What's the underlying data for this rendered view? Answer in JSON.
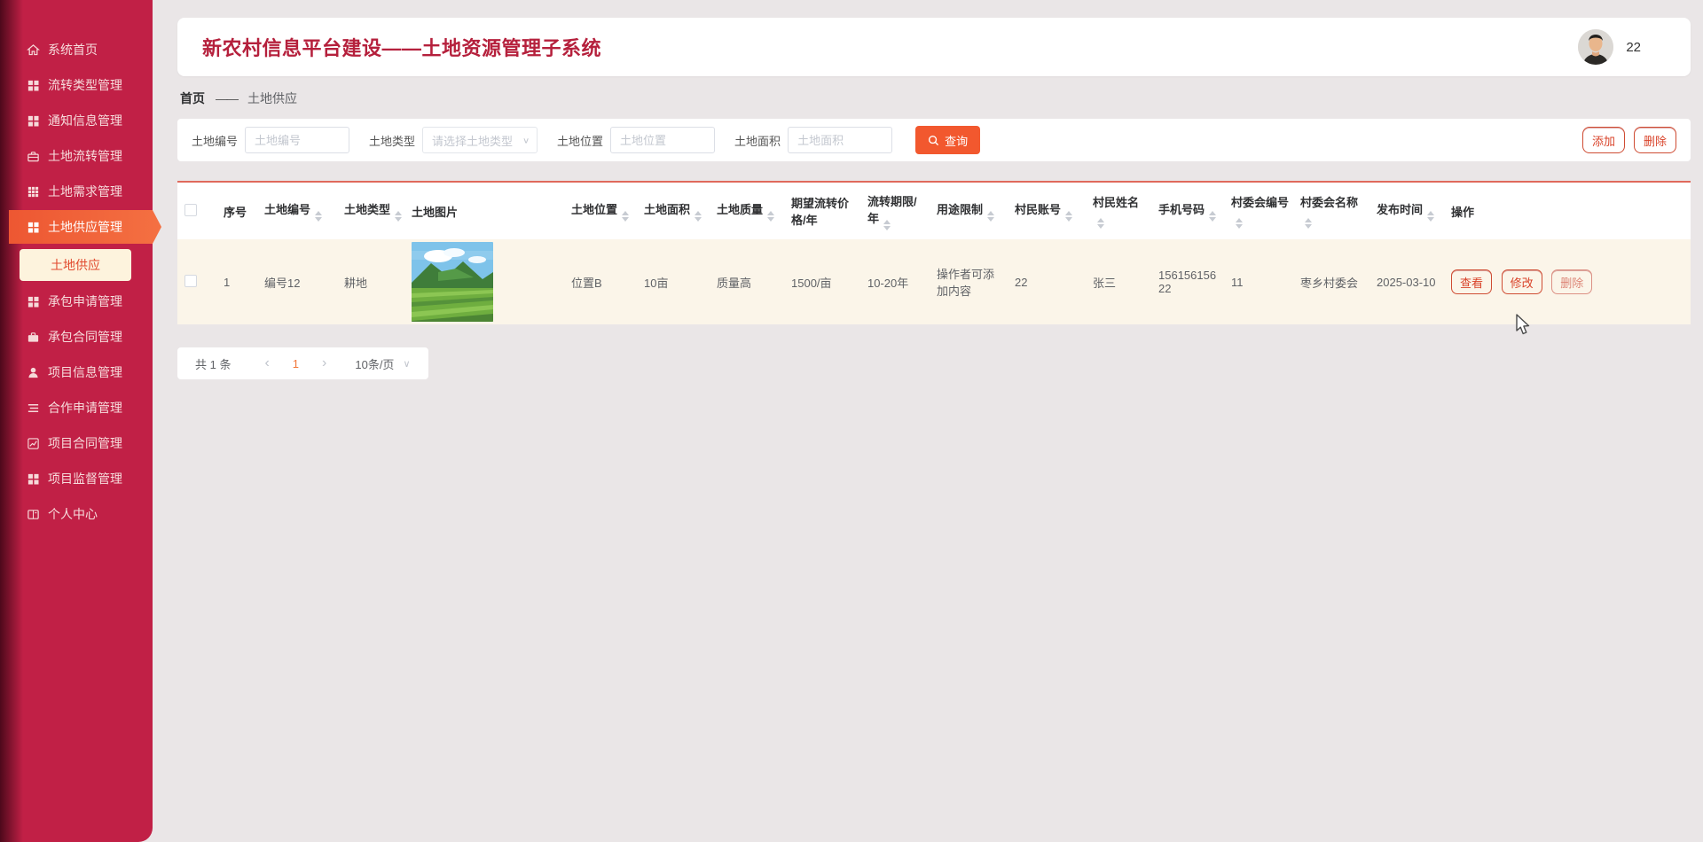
{
  "app": {
    "title": "新农村信息平台建设——土地资源管理子系统",
    "user_badge": "22"
  },
  "colors": {
    "sidebar": "#c12046",
    "active_item": "#f05a32",
    "title_red": "#b5203c",
    "primary_button": "#f2582e",
    "row_highlight": "#fbf5e9"
  },
  "sidebar": {
    "items": [
      {
        "label": "系统首页",
        "icon": "home-icon"
      },
      {
        "label": "流转类型管理",
        "icon": "grid-icon"
      },
      {
        "label": "通知信息管理",
        "icon": "grid-icon"
      },
      {
        "label": "土地流转管理",
        "icon": "briefcase-icon"
      },
      {
        "label": "土地需求管理",
        "icon": "table-grid-icon"
      },
      {
        "label": "土地供应管理",
        "icon": "grid-icon"
      },
      {
        "label": "承包申请管理",
        "icon": "grid-icon"
      },
      {
        "label": "承包合同管理",
        "icon": "briefcase-icon"
      },
      {
        "label": "项目信息管理",
        "icon": "user-icon"
      },
      {
        "label": "合作申请管理",
        "icon": "list-icon"
      },
      {
        "label": "项目合同管理",
        "icon": "chart-icon"
      },
      {
        "label": "项目监督管理",
        "icon": "grid-icon"
      },
      {
        "label": "个人中心",
        "icon": "card-icon"
      }
    ],
    "active_item": "土地供应管理",
    "submenu": {
      "label": "土地供应"
    }
  },
  "breadcrumb": {
    "root": "首页",
    "separator": "——",
    "current": "土地供应"
  },
  "filters": {
    "fields": [
      {
        "label": "土地编号",
        "placeholder": "土地编号",
        "type": "input"
      },
      {
        "label": "土地类型",
        "placeholder": "请选择土地类型",
        "type": "select"
      },
      {
        "label": "土地位置",
        "placeholder": "土地位置",
        "type": "input"
      },
      {
        "label": "土地面积",
        "placeholder": "土地面积",
        "type": "input"
      }
    ],
    "search_label": "查询",
    "add_label": "添加",
    "delete_label": "删除"
  },
  "table": {
    "columns": [
      "序号",
      "土地编号",
      "土地类型",
      "土地图片",
      "土地位置",
      "土地面积",
      "土地质量",
      "期望流转价格/年",
      "流转期限/年",
      "用途限制",
      "村民账号",
      "村民姓名",
      "手机号码",
      "村委会编号",
      "村委会名称",
      "发布时间",
      "操作"
    ],
    "rows": [
      {
        "index": "1",
        "land_no": "编号12",
        "land_type": "耕地",
        "land_image": "farmland-photo",
        "location": "位置B",
        "area": "10亩",
        "quality": "质量高",
        "expected_price": "1500/亩",
        "transfer_term": "10-20年",
        "usage_limit": "操作者可添加内容",
        "villager_account": "22",
        "villager_name": "张三",
        "phone": "15615615622",
        "committee_no": "11",
        "committee_name": "枣乡村委会",
        "publish_date": "2025-03-10",
        "actions": [
          "查看",
          "修改",
          "删除"
        ]
      }
    ]
  },
  "pagination": {
    "total": "共 1 条",
    "prev": "‹",
    "page": "1",
    "next": "›",
    "page_size": "10条/页",
    "chevron": "∨"
  },
  "select_chevron": "∨"
}
